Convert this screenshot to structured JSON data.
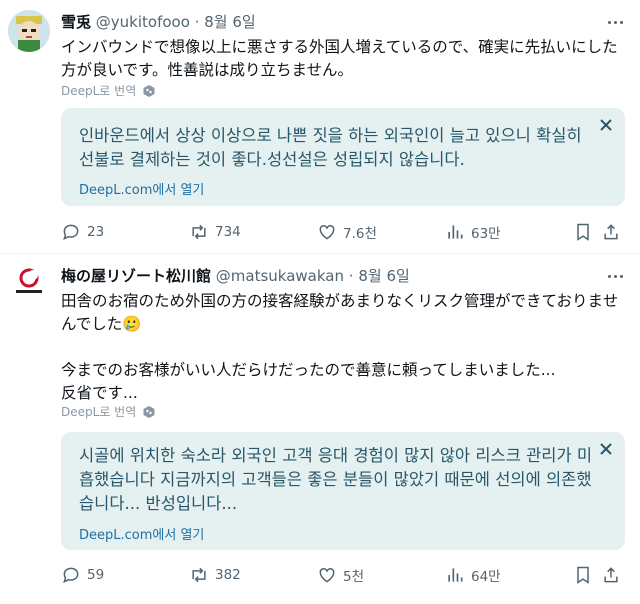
{
  "tweets": [
    {
      "name": "雪兎",
      "handle": "@yukitofooo",
      "dot": "·",
      "date": "8월 6일",
      "text": "インバウンドで想像以上に悪さする外国人増えているので、確実に先払いにした方が良いです。性善説は成り立ちません。",
      "deepl_label": "DeepL로 번역",
      "translation": "인바운드에서 상상 이상으로 나쁜 짓을 하는 외국인이 늘고 있으니 확실히 선불로 결제하는 것이 좋다.성선설은 성립되지 않습니다.",
      "deepl_link": "DeepL.com에서 열기",
      "stats": {
        "replies": "23",
        "retweets": "734",
        "likes": "7.6천",
        "views": "63만"
      }
    },
    {
      "name": "梅の屋リゾート松川館",
      "handle": "@matsukawakan",
      "dot": "·",
      "date": "8월 6일",
      "text": "田舎のお宿のため外国の方の接客経験があまりなくリスク管理ができておりませんでした🥲\n\n今までのお客様がいい人だらけだったので善意に頼ってしまいました...\n反省です...",
      "deepl_label": "DeepL로 번역",
      "translation": "시골에 위치한 숙소라 외국인 고객 응대 경험이 많지 않아 리스크 관리가 미흡했습니다 지금까지의 고객들은 좋은 분들이 많았기 때문에 선의에 의존했습니다... 반성입니다...",
      "deepl_link": "DeepL.com에서 열기",
      "stats": {
        "replies": "59",
        "retweets": "382",
        "likes": "5천",
        "views": "64만"
      }
    }
  ],
  "avatar2_text": "MATSUKAWAKAN",
  "colors": {
    "accent": "#1d9bf0",
    "muted": "#536471",
    "translation_bg": "#e5f1f0",
    "translation_text": "#28566a"
  }
}
